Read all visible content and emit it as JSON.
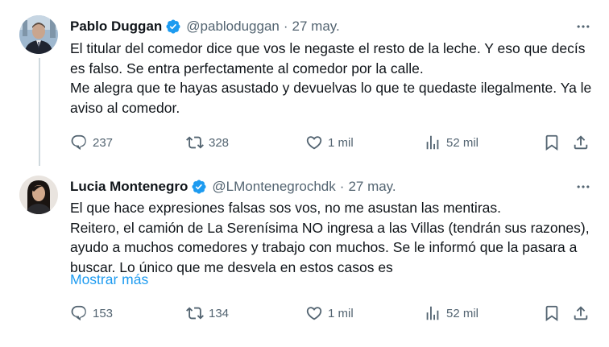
{
  "tweets": [
    {
      "author": "Pablo Duggan",
      "handle": "@pabloduggan",
      "separator": "·",
      "date": "27 may.",
      "text": "El titular del comedor dice que vos le negaste el resto de la leche. Y eso que decís es falso. Se entra perfectamente al comedor por la calle.\nMe alegra que te hayas asustado y devuelvas lo que te quedaste ilegalmente. Ya le aviso al comedor.",
      "replies": "237",
      "retweets": "328",
      "likes": "1 mil",
      "views": "52 mil"
    },
    {
      "author": "Lucia Montenegro",
      "handle": "@LMontenegrochdk",
      "separator": "·",
      "date": "27 may.",
      "text": "El que hace expresiones falsas sos vos, no me asustan las mentiras.\nReitero, el camión de La Serenísima NO ingresa a las Villas (tendrán sus razones), ayudo a muchos comedores y trabajo con muchos. Se le informó que la pasara a buscar. Lo único que me desvela en estos casos es",
      "show_more": "Mostrar más",
      "replies": "153",
      "retweets": "134",
      "likes": "1 mil",
      "views": "52 mil"
    }
  ],
  "colors": {
    "verified": "#1d9bf0",
    "link": "#1d9bf0",
    "secondary_text": "#536471",
    "thread_line": "#cfd9de"
  },
  "icons": [
    "verified-badge-icon",
    "more-icon",
    "reply-icon",
    "retweet-icon",
    "like-icon",
    "views-icon",
    "bookmark-icon",
    "share-icon"
  ]
}
